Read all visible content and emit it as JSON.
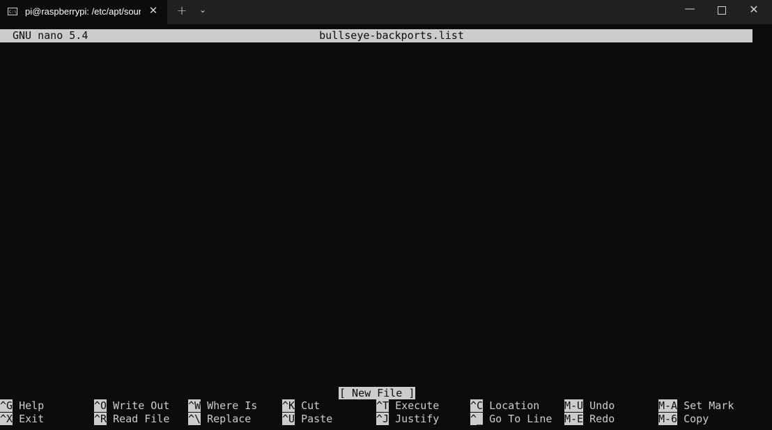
{
  "window": {
    "tab_title": "pi@raspberrypi: /etc/apt/sources.list.d",
    "tab_icon": "C:\\",
    "tab_close_glyph": "✕",
    "new_tab_glyph": "+",
    "dropdown_glyph": "⌄",
    "minimize_glyph": "—",
    "close_glyph": "✕"
  },
  "nano": {
    "version": "GNU nano 5.4",
    "filename": "bullseye-backports.list",
    "status": "[ New File ]",
    "shortcuts_row1": [
      {
        "key": "^G",
        "label": "Help"
      },
      {
        "key": "^O",
        "label": "Write Out"
      },
      {
        "key": "^W",
        "label": "Where Is"
      },
      {
        "key": "^K",
        "label": "Cut"
      },
      {
        "key": "^T",
        "label": "Execute"
      },
      {
        "key": "^C",
        "label": "Location"
      },
      {
        "key": "M-U",
        "label": "Undo"
      },
      {
        "key": "M-A",
        "label": "Set Mark"
      }
    ],
    "shortcuts_row2": [
      {
        "key": "^X",
        "label": "Exit"
      },
      {
        "key": "^R",
        "label": "Read File"
      },
      {
        "key": "^\\",
        "label": "Replace"
      },
      {
        "key": "^U",
        "label": "Paste"
      },
      {
        "key": "^J",
        "label": "Justify"
      },
      {
        "key": "^_",
        "label": "Go To Line"
      },
      {
        "key": "M-E",
        "label": "Redo"
      },
      {
        "key": "M-6",
        "label": "Copy"
      }
    ]
  }
}
